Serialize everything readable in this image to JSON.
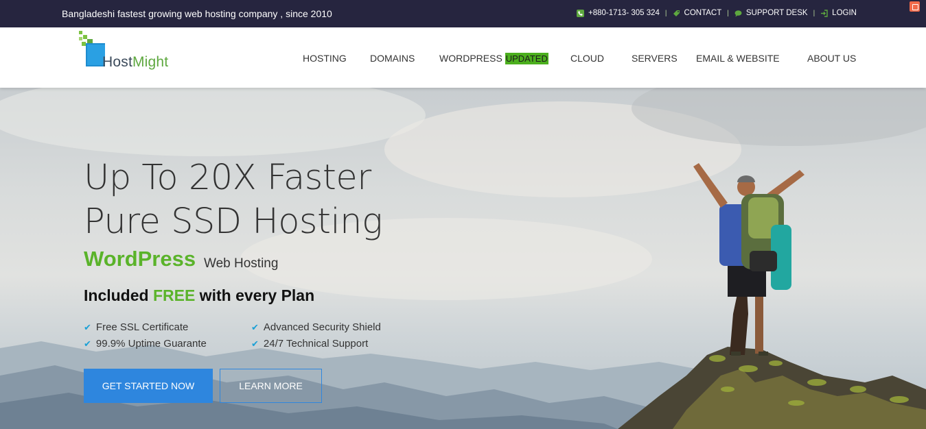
{
  "topbar": {
    "tagline": "Bangladeshi fastest growing web hosting company , since 2010",
    "phone": "+880-1713- 305 324",
    "contact": "CONTACT",
    "support": "SUPPORT DESK",
    "login": "LOGIN",
    "icons": [
      "phone-icon",
      "tag-icon",
      "chat-icon",
      "login-icon"
    ],
    "accent": "#5ea83f"
  },
  "brand": {
    "name_host": "Host",
    "name_might": "Might"
  },
  "nav": {
    "items": [
      "HOSTING",
      "DOMAINS",
      "WORDPRESS",
      "CLOUD",
      "SERVERS",
      "EMAIL & WEBSITE",
      "ABOUT US"
    ],
    "badge": "UPDATED"
  },
  "hero": {
    "line1": "Up To 20X Faster",
    "line2": "Pure SSD Hosting",
    "wp": "WordPress",
    "wp_sub": "Web Hosting",
    "included_pre": "Included ",
    "included_free": "FREE",
    "included_post": " with every Plan",
    "features": [
      "Free SSL Certificate",
      "Advanced Security Shield",
      "99.9% Uptime Guarante",
      "24/7 Technical Support"
    ],
    "cta_primary": "GET STARTED NOW",
    "cta_secondary": "LEARN MORE"
  },
  "colors": {
    "green": "#5ab32a",
    "blue": "#2e86de",
    "topbar_bg": "#26253f"
  }
}
